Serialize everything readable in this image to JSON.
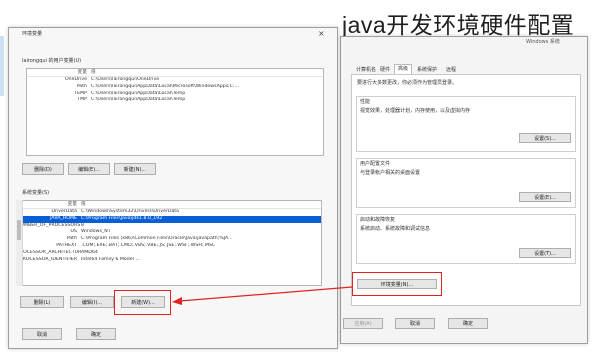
{
  "page_title": "java开发环境硬件配置",
  "env_dialog": {
    "title": "环境变量",
    "user_section_label": "lairongqui 的用户变量(U)",
    "user_table_headers": {
      "variable": "变量",
      "value": "值"
    },
    "user_vars": [
      {
        "name": "OneDrive",
        "value": "C:\\Users\\lairongqui\\OneDrive"
      },
      {
        "name": "Path",
        "value": "C:\\Users\\lairongqui\\AppData\\Local\\Microsoft\\WindowsApps;C:..."
      },
      {
        "name": "TEMP",
        "value": "C:\\Users\\lairongqui\\AppData\\Local\\Temp"
      },
      {
        "name": "TMP",
        "value": "C:\\Users\\lairongqui\\AppData\\Local\\Temp"
      }
    ],
    "user_buttons": {
      "new": "新建(N)...",
      "edit": "编辑(E)...",
      "delete": "删除(D)"
    },
    "system_section_label": "系统变量(S)",
    "system_table_headers": {
      "variable": "变量",
      "value": "值"
    },
    "system_vars": [
      {
        "name": "DriverData",
        "value": "C:\\Windows\\System32\\Drivers\\DriverData"
      },
      {
        "name": "JAVA_HOME",
        "value": "C:\\Program Files\\Java\\jdk1.8.0_192",
        "selected": true
      },
      {
        "name": "NUMBER_OF_PROCESSORS",
        "value": "8"
      },
      {
        "name": "OS",
        "value": "Windows_NT"
      },
      {
        "name": "Path",
        "value": "C:\\Program Files (x86)\\Common Files\\Oracle\\Java\\javapath;%JA..."
      },
      {
        "name": "PATHEXT",
        "value": ".COM;.EXE;.BAT;.CMD;.VBS;.VBE;.JS;.JSE;.WSF;.WSH;.MSC"
      },
      {
        "name": "PROCESSOR_ARCHITECTURE",
        "value": "AMD64"
      },
      {
        "name": "PROCESSOR_IDENTIFIER",
        "value": "Intel64 Family 6 Model ..."
      }
    ],
    "system_buttons": {
      "new": "新建(W)...",
      "edit": "编辑(I)...",
      "delete": "删除(L)"
    },
    "ok": "确定",
    "cancel": "取消"
  },
  "sys_props_dialog": {
    "window_caption": "Windows 系统",
    "tabs": [
      "计算机名",
      "硬件",
      "高级",
      "系统保护",
      "远程"
    ],
    "admin_note": "要进行大多数更改，你必须作为管理员登录。",
    "perf_title": "性能",
    "perf_desc": "视觉效果，处理器计划，内存使用，以及虚拟内存",
    "perf_button": "设置(S)...",
    "profile_title": "用户配置文件",
    "profile_desc": "与登录帐户相关的桌面设置",
    "profile_button": "设置(E)...",
    "startup_title": "启动和故障恢复",
    "startup_desc": "系统启动、系统故障和调试信息",
    "startup_button": "设置(T)...",
    "env_button": "环境变量(N)...",
    "ok": "确定",
    "cancel": "取消",
    "apply": "应用(A)"
  },
  "colors": {
    "selection": "#0a5fd6",
    "highlight_box": "#e22222",
    "arrow": "#e22222"
  }
}
